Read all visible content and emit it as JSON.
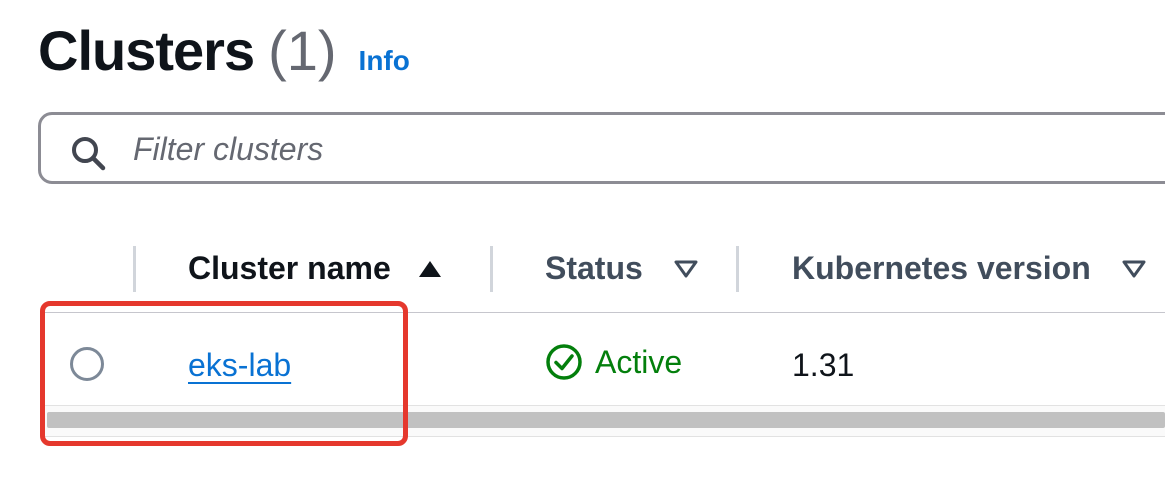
{
  "header": {
    "title": "Clusters",
    "count": "(1)",
    "info_label": "Info"
  },
  "search": {
    "placeholder": "Filter clusters",
    "value": ""
  },
  "table": {
    "columns": [
      {
        "label": "Cluster name",
        "sort": "ascending"
      },
      {
        "label": "Status",
        "sort": "none"
      },
      {
        "label": "Kubernetes version",
        "sort": "none"
      }
    ],
    "rows": [
      {
        "selected": false,
        "cluster_name": "eks-lab",
        "status": "Active",
        "kubernetes_version": "1.31"
      }
    ]
  },
  "colors": {
    "link": "#0972d3",
    "status_success": "#037f0c",
    "highlight": "#e5382d",
    "heading": "#0f141a",
    "muted": "#656871"
  },
  "icons": {
    "search": "search-icon",
    "sort_ascending": "caret-up-filled-icon",
    "sort_none": "caret-down-outline-icon",
    "status_success": "check-circle-icon"
  }
}
